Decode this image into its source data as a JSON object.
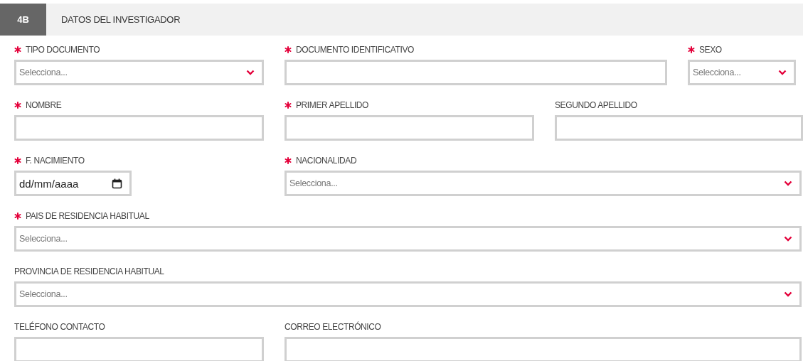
{
  "section": {
    "number": "4B",
    "title": "DATOS DEL INVESTIGADOR"
  },
  "rows": [
    {
      "fields": [
        {
          "kind": "select",
          "label": "TIPO DOCUMENTO",
          "required": true,
          "placeholder": "Selecciona..."
        },
        {
          "kind": "text",
          "label": "DOCUMENTO IDENTIFICATIVO",
          "required": true
        },
        {
          "kind": "select",
          "label": "SEXO",
          "required": true,
          "placeholder": "Selecciona..."
        }
      ]
    },
    {
      "fields": [
        {
          "kind": "text",
          "label": "NOMBRE",
          "required": true
        },
        {
          "kind": "text",
          "label": "PRIMER APELLIDO",
          "required": true
        },
        {
          "kind": "text",
          "label": "SEGUNDO APELLIDO",
          "required": false
        }
      ]
    },
    {
      "fields": [
        {
          "kind": "date",
          "label": "F. NACIMIENTO",
          "required": true,
          "value": "dd/mm/aaaa"
        },
        {
          "kind": "select",
          "label": "NACIONALIDAD",
          "required": true,
          "placeholder": "Selecciona..."
        }
      ]
    },
    {
      "fields": [
        {
          "kind": "select",
          "label": "PAIS DE RESIDENCIA HABITUAL",
          "required": true,
          "placeholder": "Selecciona..."
        }
      ]
    },
    {
      "fields": [
        {
          "kind": "select",
          "label": "PROVINCIA DE RESIDENCIA HABITUAL",
          "required": false,
          "placeholder": "Selecciona..."
        }
      ]
    },
    {
      "fields": [
        {
          "kind": "text",
          "label": "TELÉFONO CONTACTO",
          "required": false
        },
        {
          "kind": "text",
          "label": "CORREO ELECTRÓNICO",
          "required": false
        }
      ]
    }
  ]
}
